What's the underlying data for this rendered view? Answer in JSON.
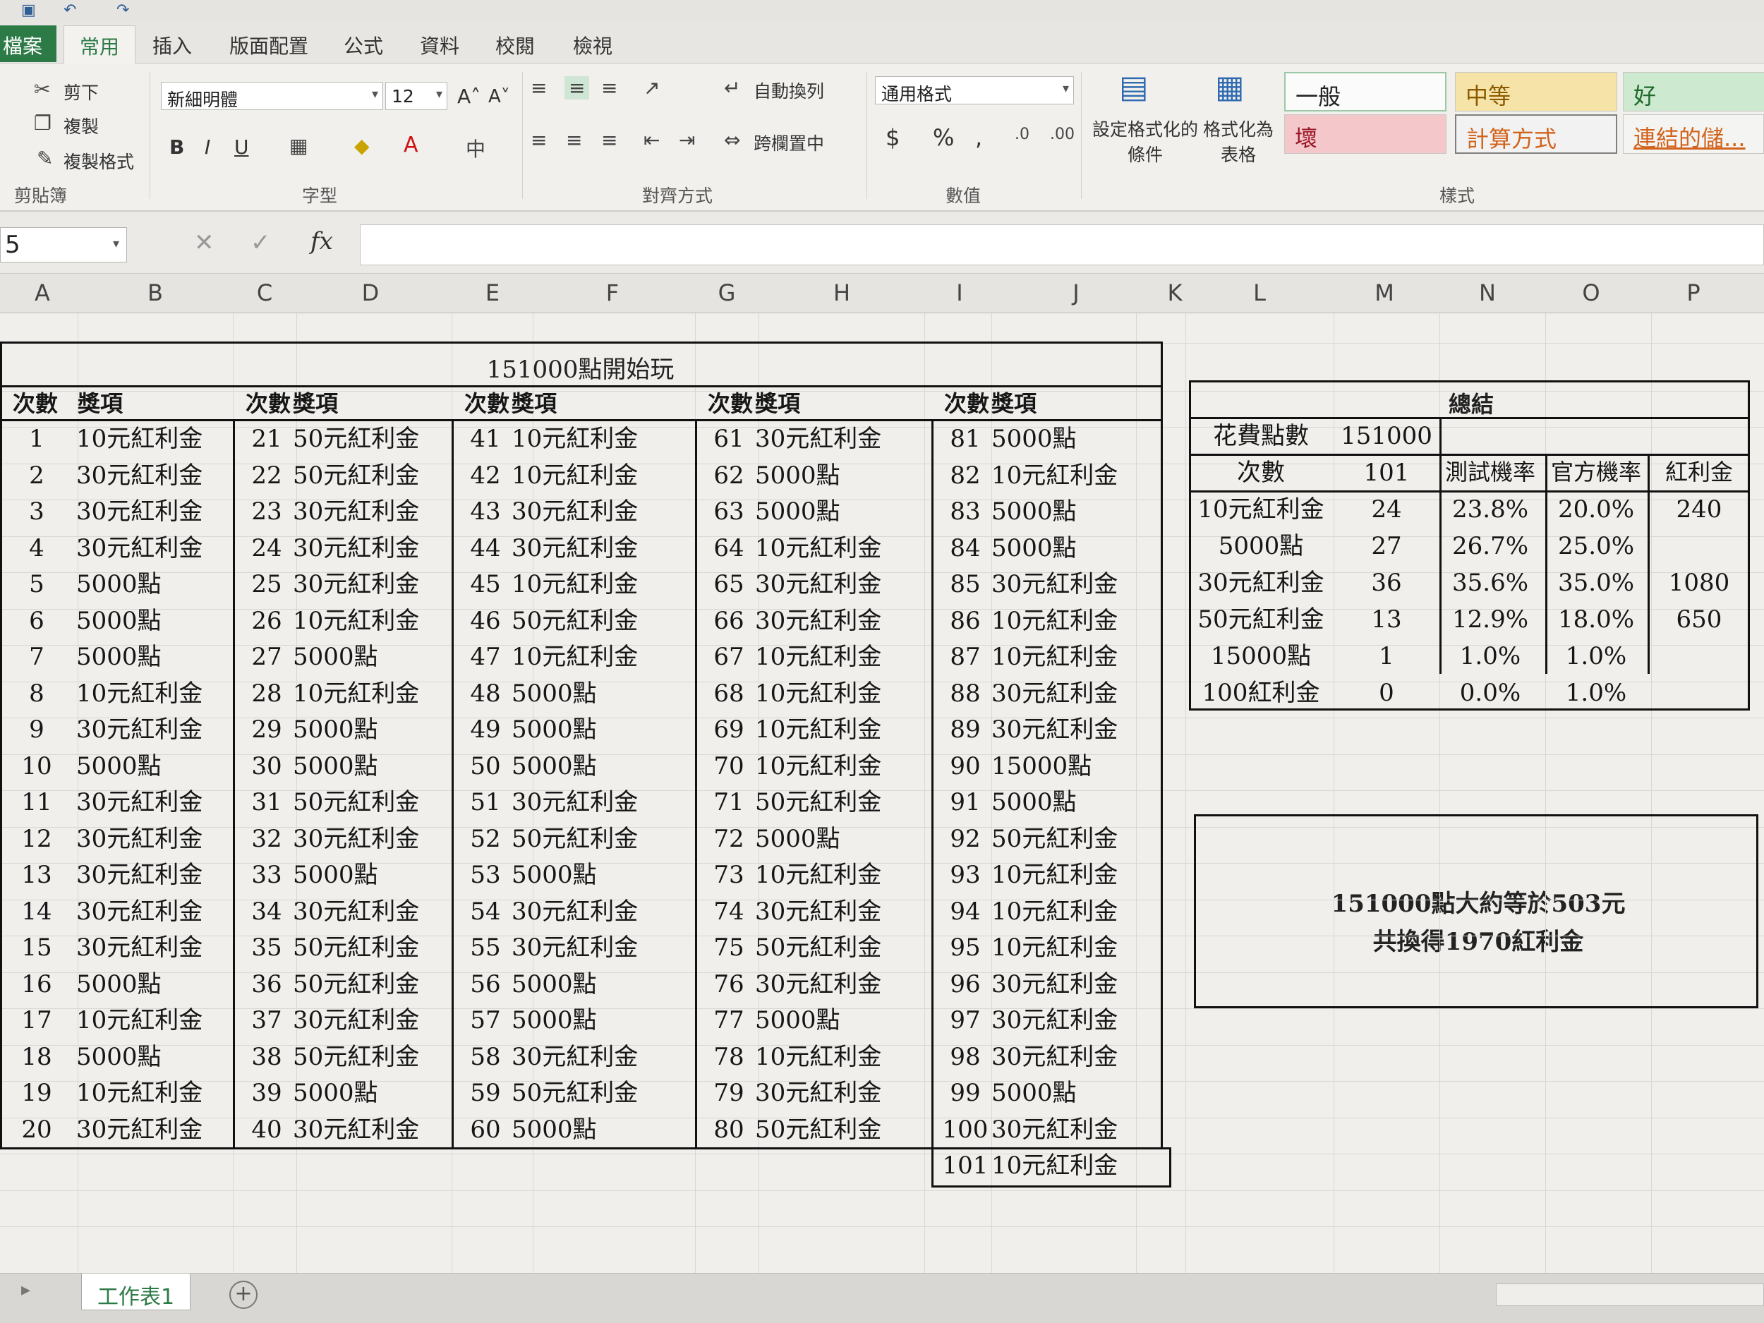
{
  "ribbon": {
    "tabs": [
      "常用",
      "插入",
      "版面配置",
      "公式",
      "資料",
      "校閱",
      "檢視"
    ],
    "file_tab": "檔案",
    "clipboard": {
      "cut": "剪下",
      "copy": "複製",
      "format_painter": "複製格式",
      "label": "剪貼簿"
    },
    "font": {
      "name": "新細明體",
      "size": "12",
      "label": "字型"
    },
    "alignment": {
      "wrap": "自動換列",
      "merge": "跨欄置中",
      "label": "對齊方式"
    },
    "number": {
      "format": "通用格式",
      "label": "數值"
    },
    "conditional": {
      "cond_format": "設定格式化的條件",
      "format_table": "格式化為表格"
    },
    "styles": {
      "normal": "一般",
      "neutral": "中等",
      "good": "好",
      "bad": "壞",
      "calc": "計算方式",
      "link": "連結的儲...",
      "label": "樣式"
    }
  },
  "formula_bar": {
    "name_box": "5",
    "fx": "fx"
  },
  "columns": [
    "A",
    "B",
    "C",
    "D",
    "E",
    "F",
    "G",
    "H",
    "I",
    "J",
    "K",
    "L",
    "M",
    "N",
    "O",
    "P"
  ],
  "sheet": {
    "title": "151000點開始玩",
    "col_count_label": "次數",
    "col_prize_label": "獎項",
    "records": [
      "10元紅利金",
      "30元紅利金",
      "30元紅利金",
      "30元紅利金",
      "5000點",
      "5000點",
      "5000點",
      "10元紅利金",
      "30元紅利金",
      "5000點",
      "30元紅利金",
      "30元紅利金",
      "30元紅利金",
      "30元紅利金",
      "30元紅利金",
      "5000點",
      "10元紅利金",
      "5000點",
      "10元紅利金",
      "30元紅利金",
      "50元紅利金",
      "50元紅利金",
      "30元紅利金",
      "30元紅利金",
      "30元紅利金",
      "10元紅利金",
      "5000點",
      "10元紅利金",
      "5000點",
      "5000點",
      "50元紅利金",
      "30元紅利金",
      "5000點",
      "30元紅利金",
      "50元紅利金",
      "50元紅利金",
      "30元紅利金",
      "50元紅利金",
      "5000點",
      "30元紅利金",
      "10元紅利金",
      "10元紅利金",
      "30元紅利金",
      "30元紅利金",
      "10元紅利金",
      "50元紅利金",
      "10元紅利金",
      "5000點",
      "5000點",
      "5000點",
      "30元紅利金",
      "50元紅利金",
      "5000點",
      "30元紅利金",
      "30元紅利金",
      "5000點",
      "5000點",
      "30元紅利金",
      "50元紅利金",
      "5000點",
      "30元紅利金",
      "5000點",
      "5000點",
      "10元紅利金",
      "30元紅利金",
      "30元紅利金",
      "10元紅利金",
      "10元紅利金",
      "10元紅利金",
      "10元紅利金",
      "50元紅利金",
      "5000點",
      "10元紅利金",
      "30元紅利金",
      "50元紅利金",
      "30元紅利金",
      "5000點",
      "10元紅利金",
      "30元紅利金",
      "50元紅利金",
      "5000點",
      "10元紅利金",
      "5000點",
      "5000點",
      "30元紅利金",
      "10元紅利金",
      "10元紅利金",
      "30元紅利金",
      "30元紅利金",
      "15000點",
      "5000點",
      "50元紅利金",
      "10元紅利金",
      "10元紅利金",
      "10元紅利金",
      "30元紅利金",
      "30元紅利金",
      "30元紅利金",
      "5000點",
      "30元紅利金",
      "10元紅利金"
    ]
  },
  "summary": {
    "title": "總結",
    "spent_label": "花費點數",
    "spent_value": "151000",
    "count_label": "次數",
    "count_value": "101",
    "h_test": "測試機率",
    "h_official": "官方機率",
    "h_bonus": "紅利金",
    "rows": [
      {
        "item": "10元紅利金",
        "count": "24",
        "test": "23.8%",
        "official": "20.0%",
        "bonus": "240"
      },
      {
        "item": "5000點",
        "count": "27",
        "test": "26.7%",
        "official": "25.0%",
        "bonus": ""
      },
      {
        "item": "30元紅利金",
        "count": "36",
        "test": "35.6%",
        "official": "35.0%",
        "bonus": "1080"
      },
      {
        "item": "50元紅利金",
        "count": "13",
        "test": "12.9%",
        "official": "18.0%",
        "bonus": "650"
      },
      {
        "item": "15000點",
        "count": "1",
        "test": "1.0%",
        "official": "1.0%",
        "bonus": ""
      },
      {
        "item": "100紅利金",
        "count": "0",
        "test": "0.0%",
        "official": "1.0%",
        "bonus": ""
      }
    ]
  },
  "note": {
    "line1": "151000點大約等於503元",
    "line2": "共換得1970紅利金"
  },
  "sheet_tab": "工作表1"
}
